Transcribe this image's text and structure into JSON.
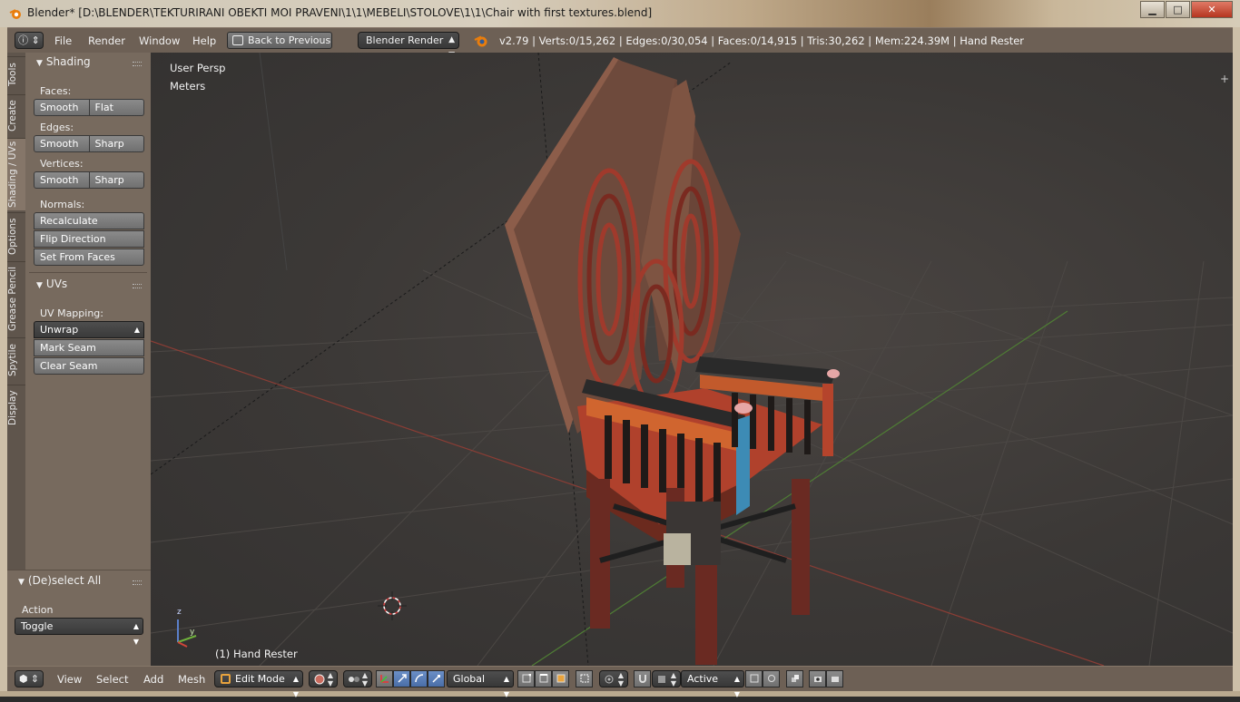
{
  "window": {
    "title": "Blender* [D:\\BLENDER\\TEKTURIRANI OBEKTI MOI PRAVENI\\1\\1\\MEBELI\\STOLOVE\\1\\1\\Chair with first textures.blend]",
    "minimize": "▁",
    "maximize": "□",
    "close": "✕"
  },
  "info_header": {
    "editor_icon": "ⓘ",
    "menus": [
      "File",
      "Render",
      "Window",
      "Help"
    ],
    "back_to_previous": "Back to Previous",
    "render_engine": "Blender Render",
    "stats": "v2.79 | Verts:0/15,262 | Edges:0/30,054 | Faces:0/14,915 | Tris:30,262 | Mem:224.39M | Hand Rester"
  },
  "tabs": [
    "Tools",
    "Create",
    "Shading / UVs",
    "Options",
    "Grease Pencil",
    "Spytile",
    "Display"
  ],
  "shading_panel": {
    "title": "Shading",
    "faces_label": "Faces:",
    "faces_smooth": "Smooth",
    "faces_flat": "Flat",
    "edges_label": "Edges:",
    "edges_smooth": "Smooth",
    "edges_sharp": "Sharp",
    "vertices_label": "Vertices:",
    "vertices_smooth": "Smooth",
    "vertices_sharp": "Sharp",
    "normals_label": "Normals:",
    "recalculate": "Recalculate",
    "flip_direction": "Flip Direction",
    "set_from_faces": "Set From Faces"
  },
  "uvs_panel": {
    "title": "UVs",
    "mapping_label": "UV Mapping:",
    "unwrap": "Unwrap",
    "mark_seam": "Mark Seam",
    "clear_seam": "Clear Seam"
  },
  "operator_panel": {
    "title": "(De)select All",
    "action_label": "Action",
    "action_value": "Toggle"
  },
  "viewport": {
    "view_name": "User Persp",
    "units": "Meters",
    "object_label": "(1) Hand Rester",
    "axis_z": "z",
    "axis_y": "y"
  },
  "bottom_header": {
    "menus": [
      "View",
      "Select",
      "Add",
      "Mesh"
    ],
    "mode": "Edit Mode",
    "orientation": "Global",
    "pivot_active": "Active"
  },
  "colors": {
    "header_bg": "#6d6055",
    "shelf_bg": "#776a5e",
    "active_blue": "#4a6ea8",
    "chair_red": "#9c3a28",
    "chair_back": "#6e4a3c"
  }
}
